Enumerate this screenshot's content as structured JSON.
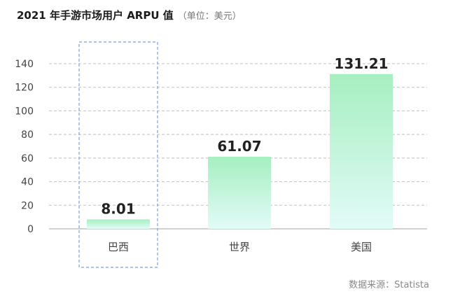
{
  "title": "2021 年手游市场用户 ARPU 值",
  "unit": "（单位：美元）",
  "source": "数据来源：Statista",
  "chart_data": {
    "type": "bar",
    "categories": [
      "巴西",
      "世界",
      "美国"
    ],
    "values": [
      8.01,
      61.07,
      131.21
    ],
    "value_labels": [
      "8.01",
      "61.07",
      "131.21"
    ],
    "yticks": [
      0,
      20,
      40,
      60,
      80,
      100,
      120,
      140
    ],
    "ylim": [
      0,
      140
    ],
    "grid": true,
    "highlighted_category": "巴西",
    "colors": {
      "bar_top": "#a6efc0",
      "bar_bottom": "#e2fbf8",
      "highlight_box": "#7a9fe0",
      "grid": "#bfbfbf"
    }
  }
}
